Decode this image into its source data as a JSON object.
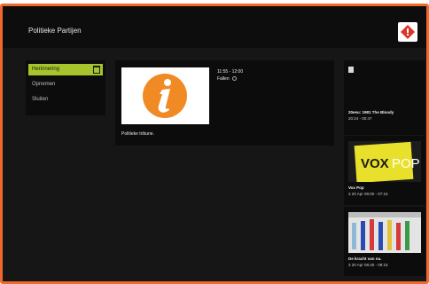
{
  "header": {
    "title": "Politieke Partijen",
    "logo_icon": "tv-brand-logo",
    "accent_color": "#ef6a2a"
  },
  "menu": {
    "items": [
      {
        "label": "Herinnering",
        "active": true
      },
      {
        "label": "Opnemen",
        "active": false
      },
      {
        "label": "Sluiten",
        "active": false
      }
    ],
    "active_color": "#a6c42c"
  },
  "detail": {
    "time": "11:55 - 12:00",
    "status": "Fallen",
    "name": "Politieke tribune."
  },
  "recordings": [
    {
      "title": "20eeu: 1981 The Bloody",
      "meta": "20:24 - 00:47"
    },
    {
      "title": "Vox Pop",
      "meta": "3 20 Apr 09:00 - 07:15"
    },
    {
      "title": "De kracht van nu.",
      "meta": "3 20 Apr 09:45 - 09:15"
    }
  ]
}
